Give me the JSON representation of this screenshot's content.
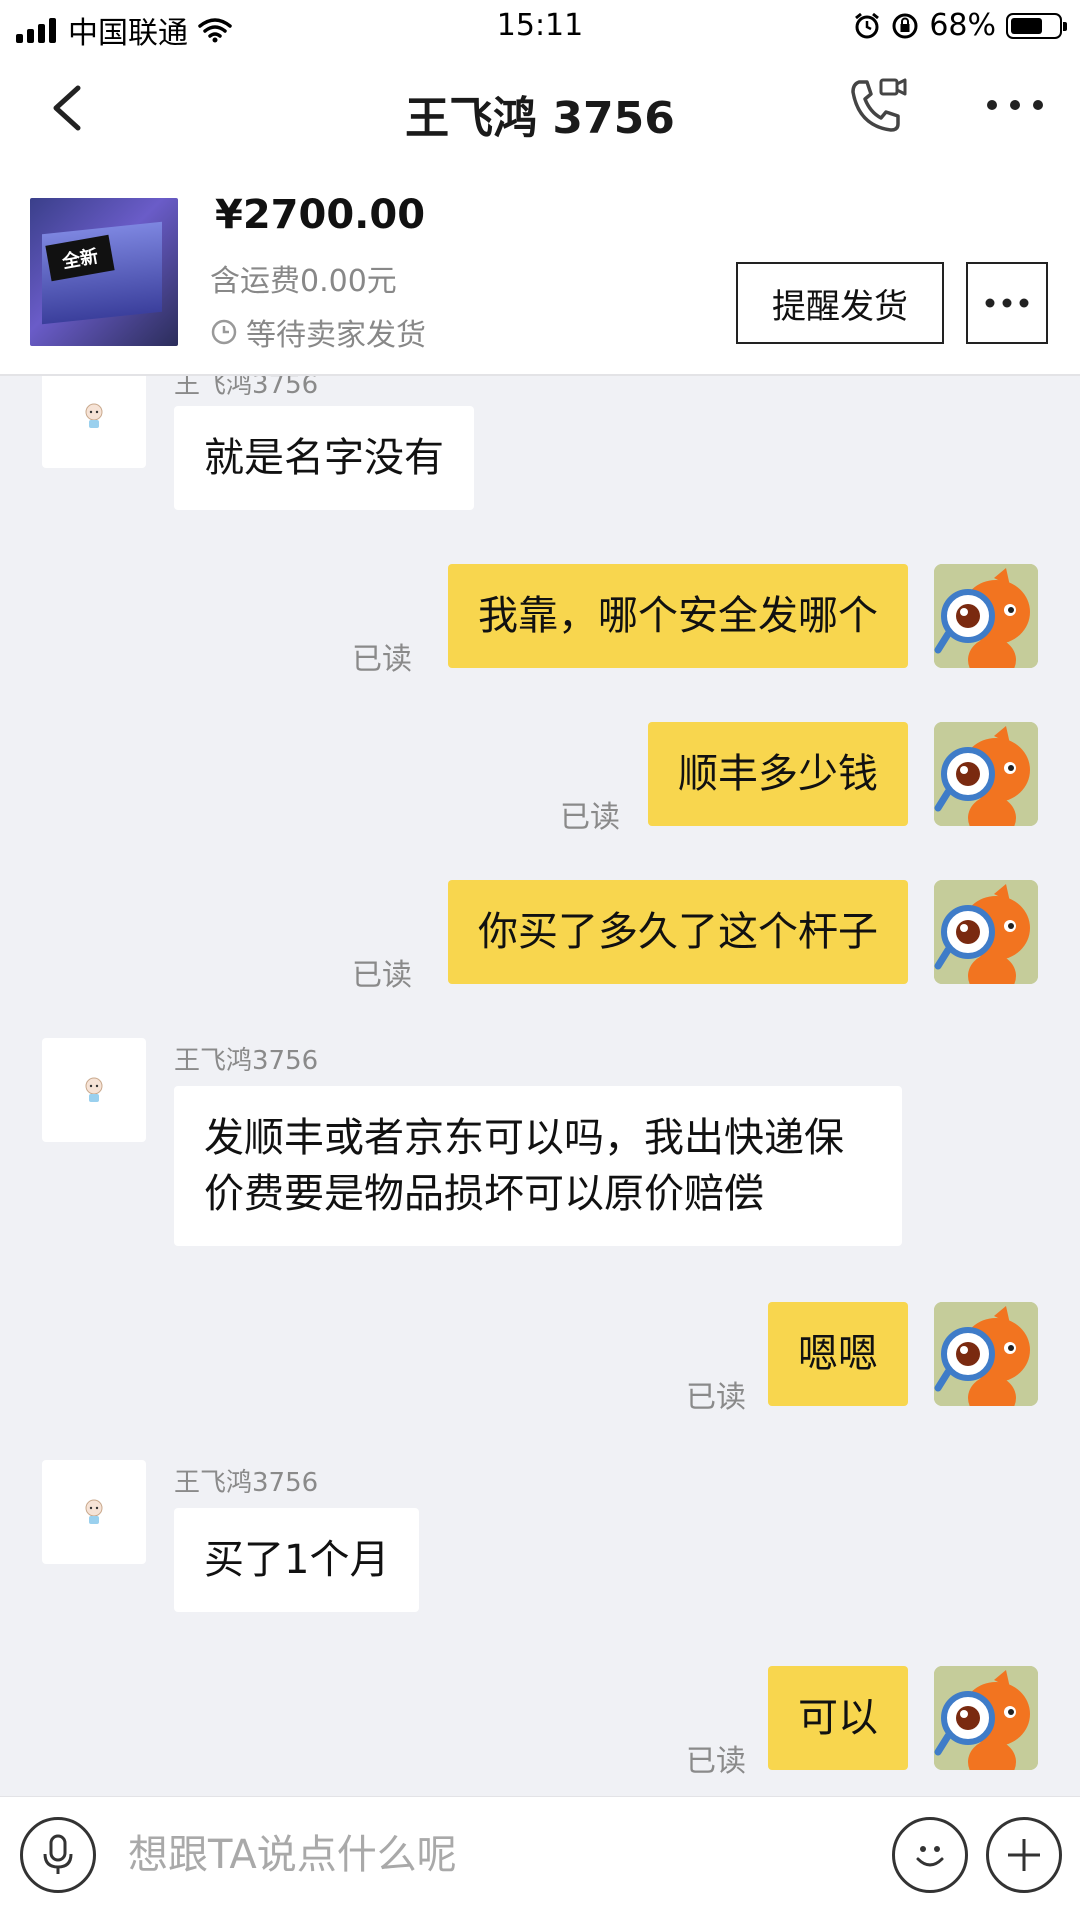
{
  "status_bar": {
    "carrier": "中国联通",
    "time": "15:11",
    "battery_text": "68%",
    "battery_level": 0.68,
    "icons": [
      "signal-icon",
      "wifi-icon",
      "alarm-icon",
      "rotation-lock-icon",
      "battery-icon"
    ]
  },
  "nav": {
    "title": "王飞鸿 3756",
    "icons": [
      "back-icon",
      "call-icon",
      "more-icon"
    ]
  },
  "order": {
    "price": "¥2700.00",
    "shipping": "含运费0.00元",
    "status": "等待卖家发货",
    "remind_button": "提醒发货",
    "thumbnail_text": "全新"
  },
  "messages": [
    {
      "from": "them",
      "name": "王飞鸿3756",
      "text": "就是名字没有"
    },
    {
      "from": "me",
      "text": "我靠，哪个安全发哪个",
      "status": "已读"
    },
    {
      "from": "me",
      "text": "顺丰多少钱",
      "status": "已读"
    },
    {
      "from": "me",
      "text": "你买了多久了这个杆子",
      "status": "已读"
    },
    {
      "from": "them",
      "name": "王飞鸿3756",
      "text": "发顺丰或者京东可以吗，我出快递保价费要是物品损坏可以原价赔偿"
    },
    {
      "from": "me",
      "text": "嗯嗯",
      "status": "已读"
    },
    {
      "from": "them",
      "name": "王飞鸿3756",
      "text": "买了1个月"
    },
    {
      "from": "me",
      "text": "可以",
      "status": "已读"
    }
  ],
  "input": {
    "placeholder": "想跟TA说点什么呢",
    "value": ""
  },
  "colors": {
    "chat_bg": "#f0f1f5",
    "my_bubble": "#f8d64e",
    "their_bubble": "#ffffff",
    "secondary_text": "#8a8a8a"
  }
}
